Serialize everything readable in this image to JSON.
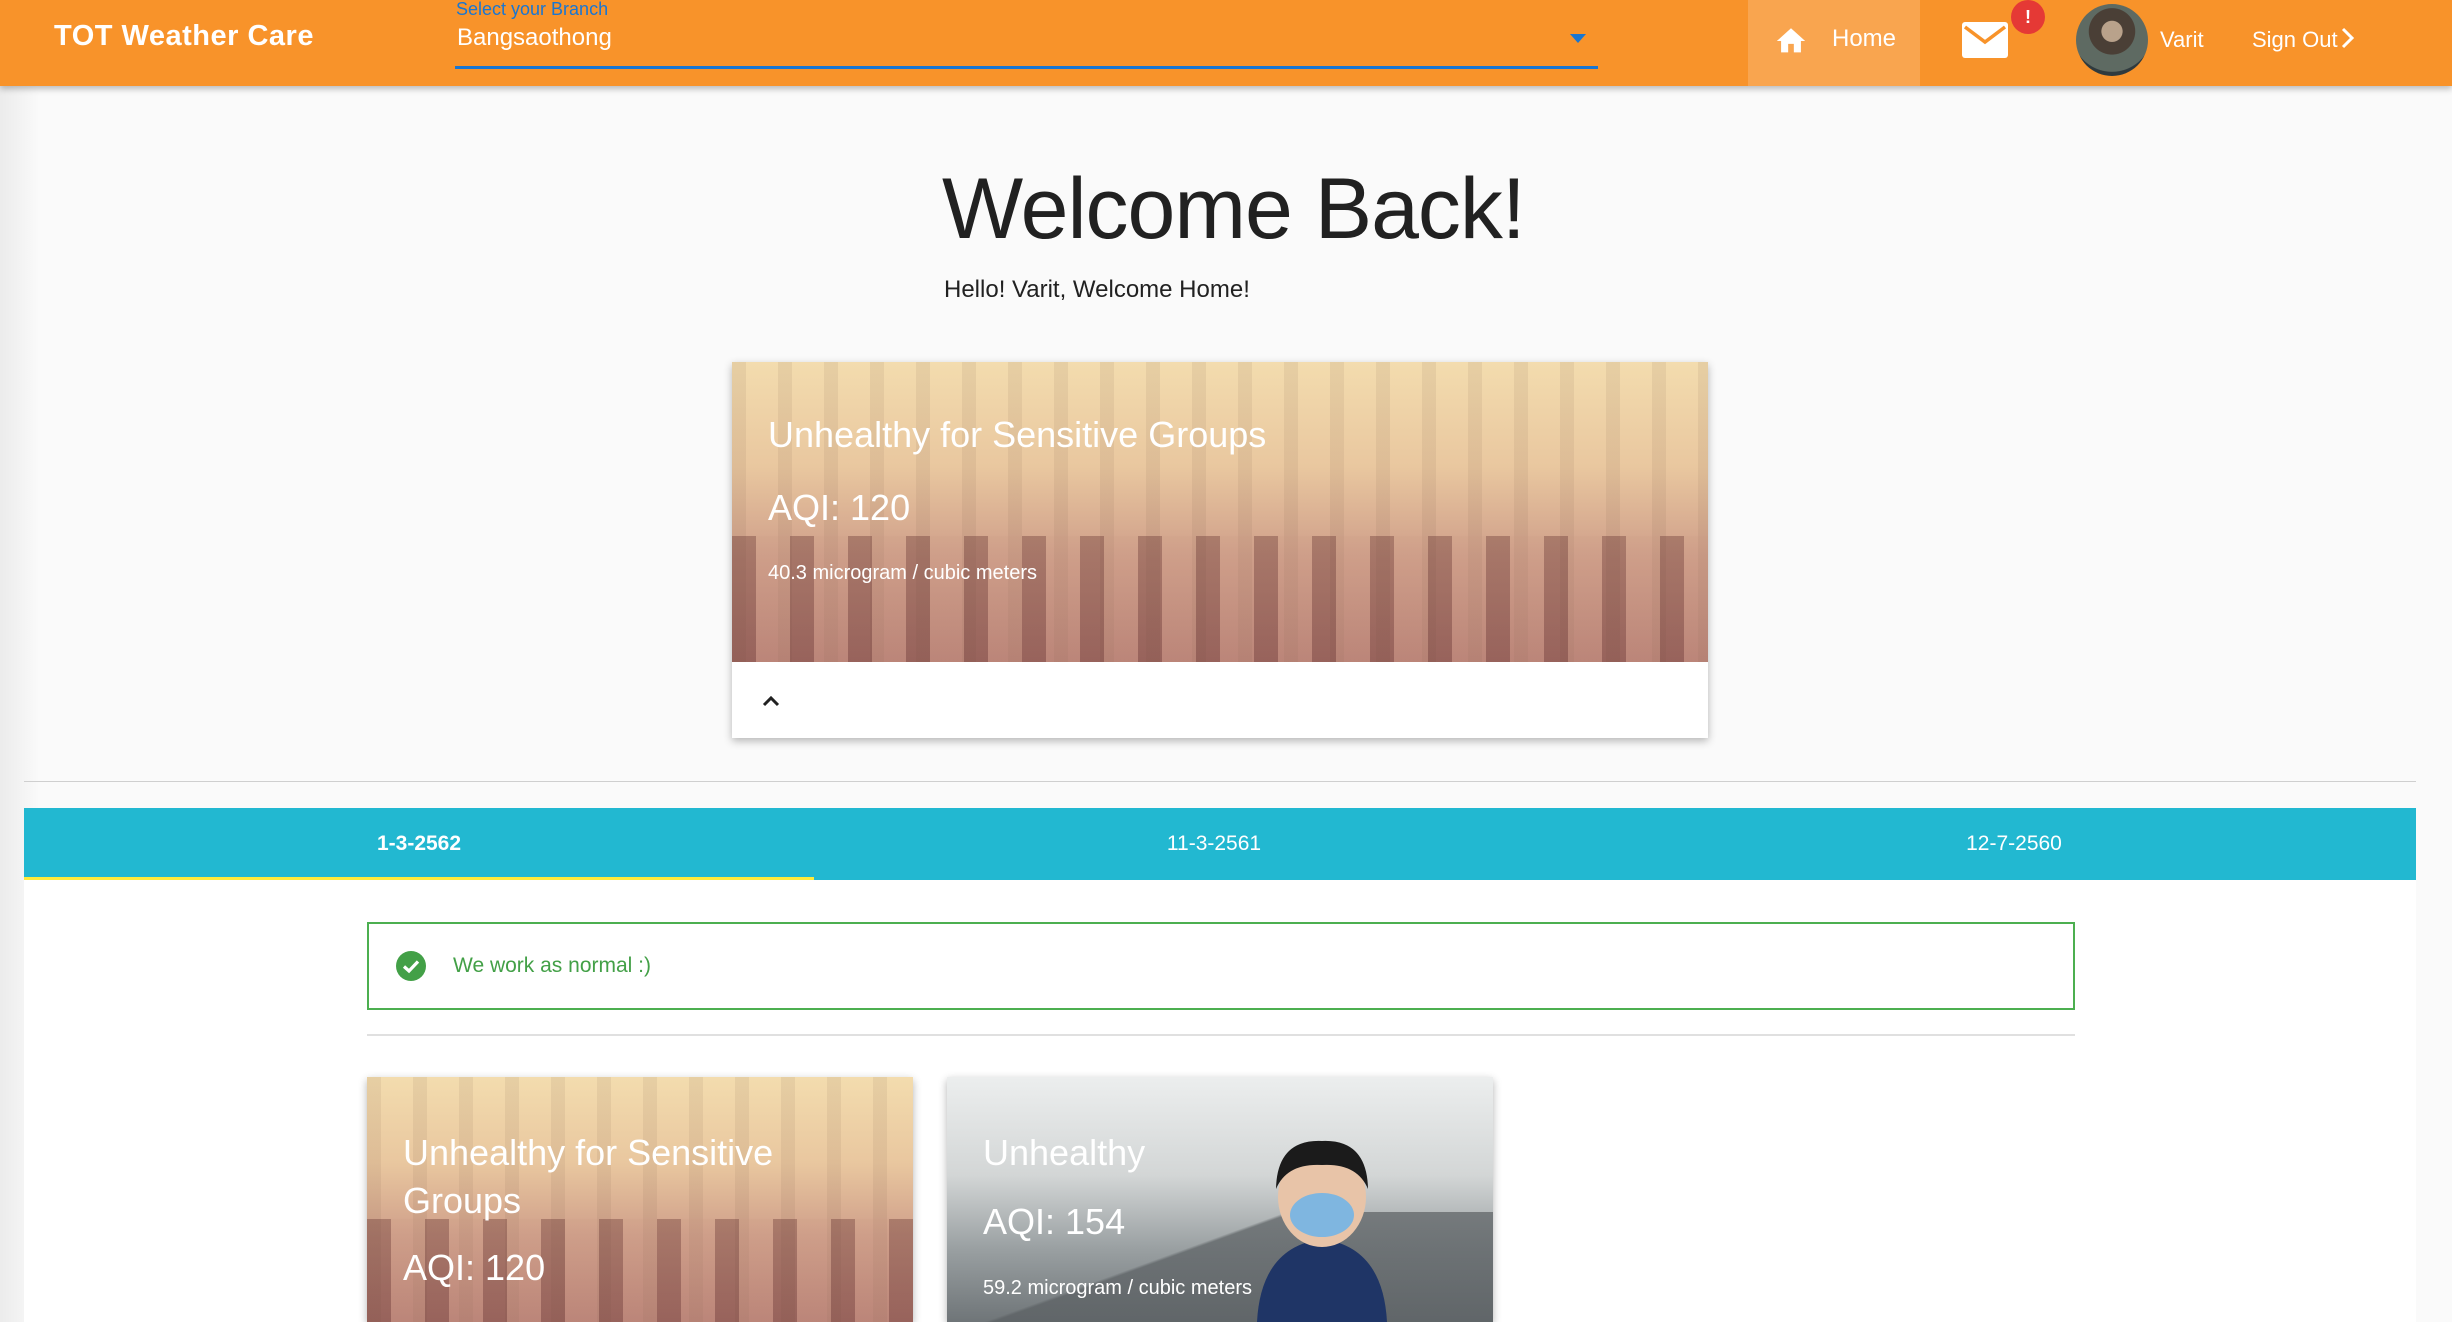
{
  "header": {
    "brand": "TOT Weather Care",
    "branch_label": "Select your Branch",
    "branch_value": "Bangsaothong",
    "home_label": "Home",
    "mail_badge": "!",
    "user_name": "Varit",
    "signout_label": "Sign Out"
  },
  "welcome": {
    "title": "Welcome Back!",
    "subtitle": "Hello! Varit, Welcome Home!"
  },
  "main_card": {
    "level": "Unhealthy for Sensitive Groups",
    "aqi": "AQI: 120",
    "concentration": "40.3 microgram / cubic meters"
  },
  "tabs": [
    {
      "label": "1-3-2562",
      "active": true
    },
    {
      "label": "11-3-2561",
      "active": false
    },
    {
      "label": "12-7-2560",
      "active": false
    }
  ],
  "status": {
    "text": "We work as normal :)",
    "color": "#43a047",
    "icon": "check-circle-icon"
  },
  "history_cards": [
    {
      "level": "Unhealthy for Sensitive Groups",
      "aqi": "AQI: 120",
      "concentration": ""
    },
    {
      "level": "Unhealthy",
      "aqi": "AQI: 154",
      "concentration": "59.2 microgram / cubic meters"
    }
  ],
  "colors": {
    "app_bar": "#f8932a",
    "tab_bar": "#22b8d1",
    "accent": "#1976d2",
    "badge": "#e53935"
  }
}
